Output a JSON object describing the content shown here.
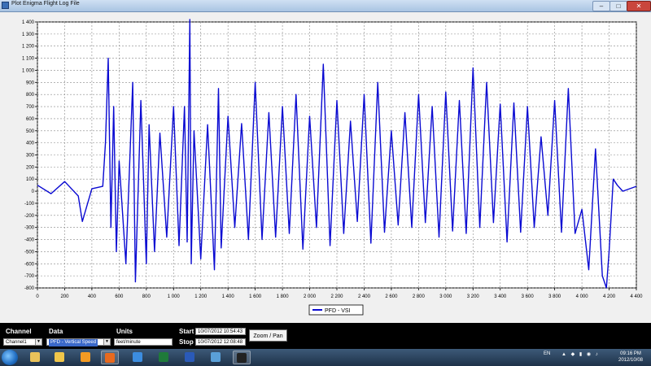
{
  "window": {
    "title": "Plot Enigma Flight Log File",
    "controls": {
      "minimize": "–",
      "maximize": "□",
      "close": "✕"
    }
  },
  "chart_data": {
    "type": "line",
    "title": "",
    "xlabel": "",
    "ylabel": "",
    "xlim": [
      0,
      4400
    ],
    "ylim": [
      -800,
      1400
    ],
    "grid": true,
    "legend_position": "bottom-center",
    "x_ticks": [
      "0",
      "200",
      "400",
      "600",
      "800",
      "1 000",
      "1 200",
      "1 400",
      "1 600",
      "1 800",
      "2 000",
      "2 200",
      "2 400",
      "2 600",
      "2 800",
      "3 000",
      "3 200",
      "3 400",
      "3 600",
      "3 800",
      "4 000",
      "4 200",
      "4 400"
    ],
    "y_ticks": [
      "1 400",
      "1 300",
      "1 200",
      "1 100",
      "1 000",
      "900",
      "800",
      "700",
      "600",
      "500",
      "400",
      "300",
      "200",
      "100",
      "0",
      "-100",
      "-200",
      "-300",
      "-400",
      "-500",
      "-600",
      "-700",
      "-800"
    ],
    "series": [
      {
        "name": "PFD - VSI",
        "color": "#0a0ad2",
        "x": [
          0,
          100,
          200,
          300,
          330,
          400,
          480,
          500,
          520,
          540,
          560,
          580,
          600,
          650,
          700,
          720,
          760,
          800,
          820,
          860,
          900,
          950,
          1000,
          1040,
          1080,
          1100,
          1120,
          1130,
          1150,
          1200,
          1250,
          1300,
          1330,
          1350,
          1400,
          1450,
          1500,
          1550,
          1600,
          1650,
          1700,
          1750,
          1800,
          1850,
          1900,
          1950,
          2000,
          2050,
          2100,
          2150,
          2200,
          2250,
          2300,
          2350,
          2400,
          2450,
          2500,
          2550,
          2600,
          2650,
          2700,
          2750,
          2800,
          2850,
          2900,
          2950,
          3000,
          3050,
          3100,
          3150,
          3200,
          3250,
          3300,
          3350,
          3400,
          3450,
          3500,
          3550,
          3600,
          3650,
          3700,
          3750,
          3800,
          3850,
          3900,
          3950,
          4000,
          4050,
          4100,
          4150,
          4180,
          4200,
          4230,
          4260,
          4300,
          4350,
          4400
        ],
        "y": [
          50,
          -20,
          80,
          -40,
          -250,
          20,
          40,
          400,
          1100,
          -300,
          700,
          -500,
          250,
          -600,
          900,
          -750,
          750,
          -600,
          550,
          -500,
          480,
          -380,
          700,
          -450,
          700,
          -420,
          1420,
          -600,
          500,
          -560,
          550,
          -650,
          850,
          -470,
          620,
          -300,
          560,
          -400,
          900,
          -400,
          650,
          -380,
          700,
          -350,
          800,
          -480,
          620,
          -300,
          1050,
          -450,
          750,
          -350,
          580,
          -250,
          800,
          -430,
          900,
          -340,
          500,
          -280,
          650,
          -300,
          800,
          -260,
          700,
          -380,
          820,
          -330,
          750,
          -350,
          1020,
          -300,
          900,
          -260,
          720,
          -420,
          730,
          -340,
          700,
          -300,
          450,
          -200,
          750,
          -340,
          850,
          -350,
          -150,
          -650,
          350,
          -700,
          -800,
          -500,
          100,
          50,
          0,
          20,
          40
        ]
      }
    ]
  },
  "controls": {
    "channel_label": "Channel",
    "channel_value": "Channel1",
    "data_label": "Data",
    "data_value": "PFD - Vertical Speed",
    "units_label": "Units",
    "units_value": "feet/minute",
    "start_label": "Start",
    "start_value": "10/07/2012 10:54:43",
    "stop_label": "Stop",
    "stop_value": "10/07/2012 12:08:48",
    "zoom_button": "Zoom / Pan"
  },
  "taskbar": {
    "language": "EN",
    "time": "09:16 PM",
    "date": "2012/10/08",
    "items": [
      {
        "icon": "windows-explorer-icon",
        "color": "#e9c25a"
      },
      {
        "icon": "folder-icon",
        "color": "#f0c64a"
      },
      {
        "icon": "media-player-icon",
        "color": "#f39a23"
      },
      {
        "icon": "firefox-icon",
        "color": "#e86a1f",
        "active": true
      },
      {
        "icon": "internet-explorer-icon",
        "color": "#3c8de0"
      },
      {
        "icon": "excel-icon",
        "color": "#1f7a3a"
      },
      {
        "icon": "word-icon",
        "color": "#2a5ab8"
      },
      {
        "icon": "app-a-icon",
        "color": "#5aa0d8"
      },
      {
        "icon": "plot-enigma-icon",
        "color": "#222222",
        "active": true
      }
    ]
  }
}
